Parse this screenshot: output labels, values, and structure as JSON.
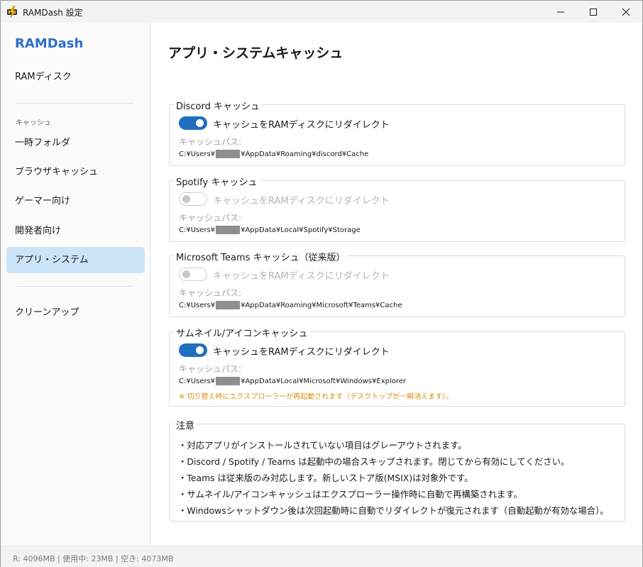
{
  "window": {
    "title": "RAMDash 設定",
    "icon": "lightning-app-icon"
  },
  "sidebar": {
    "brand": "RAMDash",
    "top_item": "RAMディスク",
    "section_label": "キャッシュ",
    "items": [
      {
        "label": "一時フォルダ",
        "active": false
      },
      {
        "label": "ブラウザキャッシュ",
        "active": false
      },
      {
        "label": "ゲーマー向け",
        "active": false
      },
      {
        "label": "開発者向け",
        "active": false
      },
      {
        "label": "アプリ・システム",
        "active": true
      }
    ],
    "bottom_item": "クリーンアップ"
  },
  "main": {
    "title": "アプリ・システムキャッシュ",
    "groups": [
      {
        "header": "Discord キャッシュ",
        "toggle_on": true,
        "toggle_label": "キャッシュをRAMディスクにリダイレクト",
        "path_label": "キャッシュパス:",
        "path_prefix": "C:¥Users¥",
        "path_suffix": "¥AppData¥Roaming¥discord¥Cache"
      },
      {
        "header": "Spotify キャッシュ",
        "toggle_on": false,
        "toggle_label": "キャッシュをRAMディスクにリダイレクト",
        "path_label": "キャッシュパス:",
        "path_prefix": "C:¥Users¥",
        "path_suffix": "¥AppData¥Local¥Spotify¥Storage"
      },
      {
        "header": "Microsoft Teams キャッシュ（従来版）",
        "toggle_on": false,
        "toggle_label": "キャッシュをRAMディスクにリダイレクト",
        "path_label": "キャッシュパス:",
        "path_prefix": "C:¥Users¥",
        "path_suffix": "¥AppData¥Roaming¥Microsoft¥Teams¥Cache"
      },
      {
        "header": "サムネイル/アイコンキャッシュ",
        "toggle_on": true,
        "toggle_label": "キャッシュをRAMディスクにリダイレクト",
        "path_label": "キャッシュパス:",
        "path_prefix": "C:¥Users¥",
        "path_suffix": "¥AppData¥Local¥Microsoft¥Windows¥Explorer",
        "warning": "※ 切り替え時にエクスプローラーが再起動されます（デスクトップが一瞬消えます）。"
      }
    ],
    "notes": {
      "header": "注意",
      "lines": [
        "・対応アプリがインストールされていない項目はグレーアウトされます。",
        "・Discord / Spotify / Teams は起動中の場合スキップされます。閉じてから有効にしてください。",
        "・Teams は従来版のみ対応します。新しいストア版(MSIX)は対象外です。",
        "・サムネイル/アイコンキャッシュはエクスプローラー操作時に自動で再構築されます。",
        "・Windowsシャットダウン後は次回起動時に自動でリダイレクトが復元されます（自動起動が有効な場合）。"
      ]
    }
  },
  "status": {
    "text": "R: 4096MB | 使用中: 23MB | 空き: 4073MB"
  },
  "colors": {
    "accent": "#1f6fc0",
    "brand": "#2f6fc9",
    "active_nav": "#cce4f7",
    "warning": "#d9901a"
  }
}
